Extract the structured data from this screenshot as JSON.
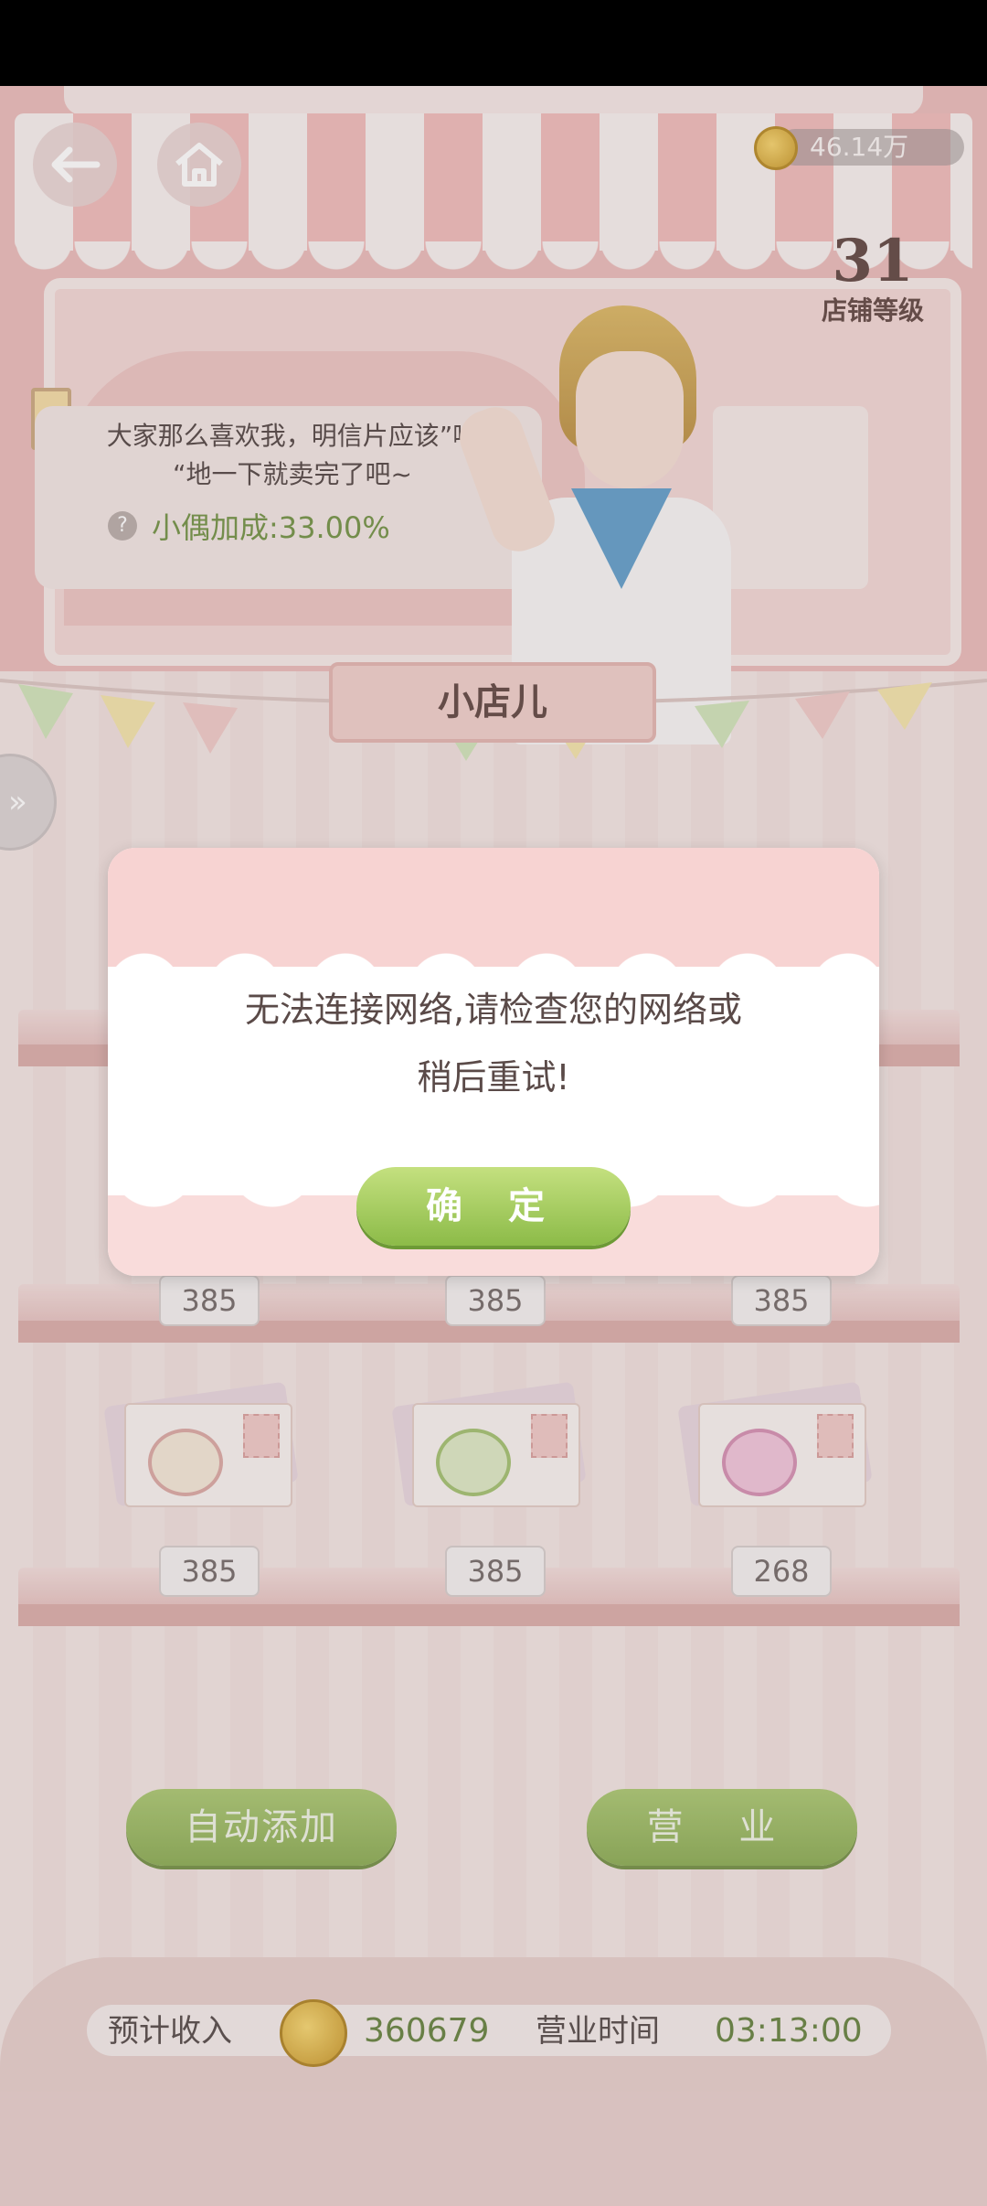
{
  "status_bar": {},
  "header": {
    "coins": "46.14万",
    "shop_level": "31",
    "shop_level_label": "店铺等级"
  },
  "speech": {
    "line1": "大家那么喜欢我，明信片应该”咻",
    "line2": "“地一下就卖完了吧~",
    "bonus": "小偶加成:33.00%"
  },
  "shop": {
    "title": "小店儿",
    "shelves": [
      {
        "prices": [
          "385",
          "385",
          "385"
        ]
      },
      {
        "prices": [
          "385",
          "385",
          "268"
        ]
      }
    ],
    "items_row2": [
      "teacup-postcard",
      "watering-can-postcard",
      "disco-ball-postcard"
    ]
  },
  "dialog": {
    "message_line1": "无法连接网络,请检查您的网络或",
    "message_line2": "稍后重试!",
    "confirm_label": "确 定"
  },
  "actions": {
    "auto_add": "自动添加",
    "open": "营 业"
  },
  "footer": {
    "expected_income_label": "预计收入",
    "expected_income_value": "360679",
    "business_time_label": "营业时间",
    "business_time_value": "03:13:00"
  },
  "colors": {
    "accent_green": "#8cbb48",
    "awning_pink": "#efb9b8",
    "dialog_pink": "#f7d3d2"
  }
}
